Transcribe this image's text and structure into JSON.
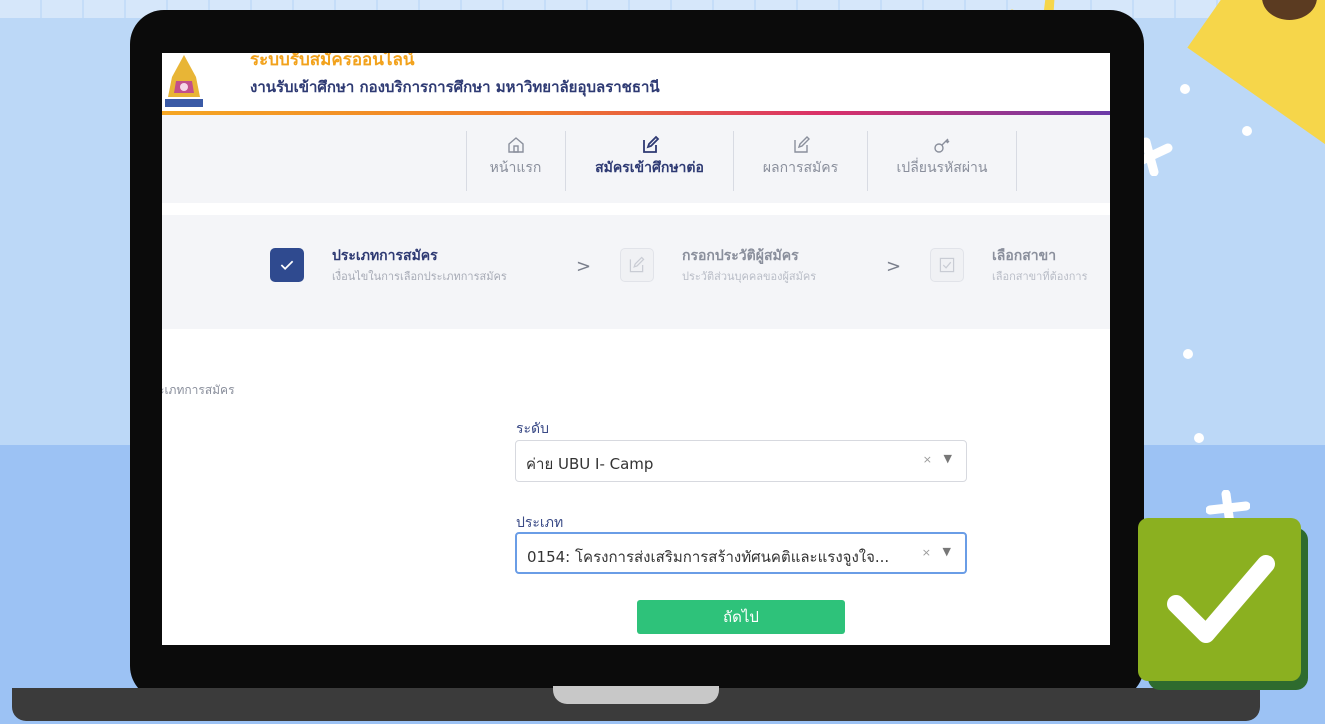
{
  "app": {
    "title": "ระบบรับสมัครออนไลน์",
    "subtitle": "งานรับเข้าศึกษา กองบริการการศึกษา มหาวิทยาลัยอุบลราชธานี"
  },
  "nav": {
    "items": [
      {
        "label": "หน้าแรก",
        "icon": "home-icon"
      },
      {
        "label": "สมัครเข้าศึกษาต่อ",
        "icon": "edit-icon",
        "active": true
      },
      {
        "label": "ผลการสมัคร",
        "icon": "edit-icon"
      },
      {
        "label": "เปลี่ยนรหัสผ่าน",
        "icon": "key-icon"
      }
    ]
  },
  "stepper": {
    "steps": [
      {
        "title": "ประเภทการสมัคร",
        "desc": "เงื่อนไขในการเลือกประเภทการสมัคร",
        "icon": "check-icon",
        "active": true
      },
      {
        "title": "กรอกประวัติผู้สมัคร",
        "desc": "ประวัติส่วนบุคคลของผู้สมัคร",
        "icon": "edit-icon"
      },
      {
        "title": "เลือกสาขา",
        "desc": "เลือกสาขาที่ต้องการ",
        "icon": "checkbox-icon"
      }
    ],
    "arrow": ">"
  },
  "form": {
    "breadcrumb": "ะเภทการสมัคร",
    "level": {
      "label": "ระดับ",
      "value": "ค่าย UBU I- Camp"
    },
    "type": {
      "label": "ประเภท",
      "value": "0154: โครงการส่งเสริมการสร้างทัศนคติและแรงจูงใจ..."
    },
    "clear_symbol": "×",
    "caret_symbol": "▼",
    "next_button": "ถัดไป"
  },
  "colors": {
    "brand_orange": "#f2a21c",
    "brand_navy": "#2e3a73",
    "button_green": "#2ec27a",
    "badge_green": "#8bb020"
  }
}
